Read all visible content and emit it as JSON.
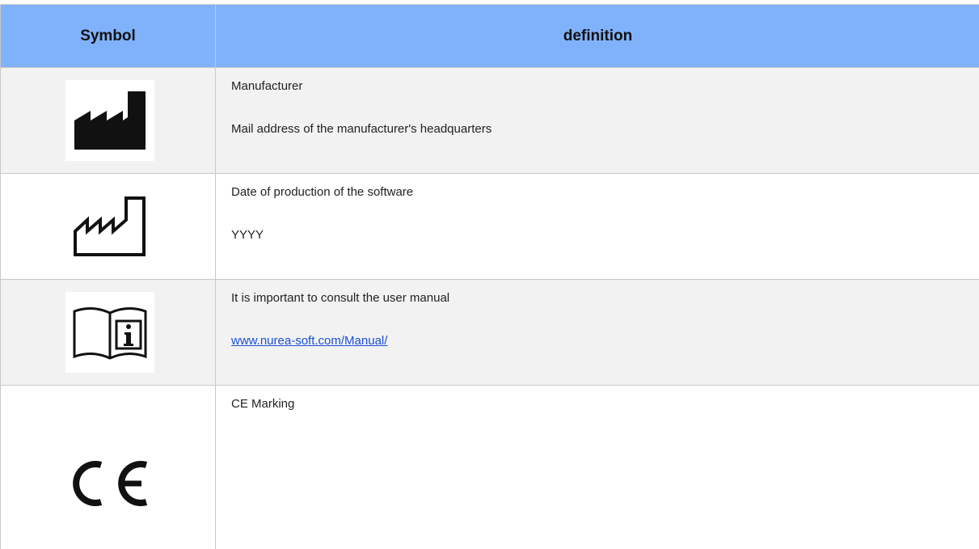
{
  "header": {
    "symbol_label": "Symbol",
    "definition_label": "definition"
  },
  "rows": [
    {
      "icon": "manufacturer-icon",
      "line1": "Manufacturer",
      "line2": "Mail address of the manufacturer's headquarters"
    },
    {
      "icon": "date-of-manufacture-icon",
      "line1": "Date of production of the software",
      "line2": "YYYY"
    },
    {
      "icon": "consult-instructions-icon",
      "line1": "It is important to consult the user manual",
      "line2": "www.nurea-soft.com/Manual/"
    },
    {
      "icon": "ce-marking-icon",
      "line1": "CE Marking",
      "line2": ""
    }
  ],
  "colors": {
    "header_bg": "#80b2fb",
    "shaded_row_bg": "#f2f2f2",
    "link": "#1a4fd6"
  }
}
